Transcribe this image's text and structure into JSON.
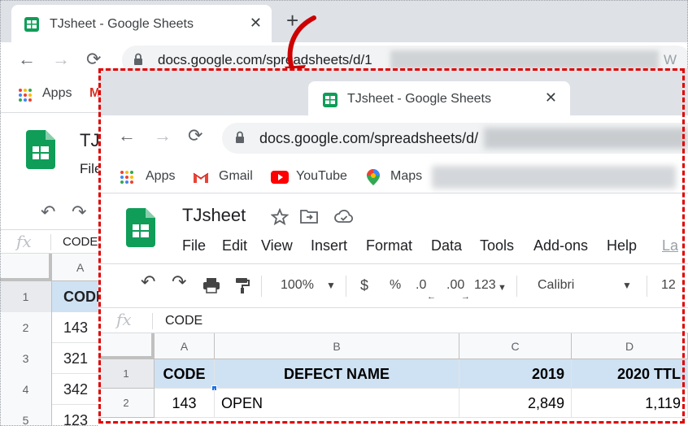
{
  "background_window": {
    "tab_title": "TJsheet - Google Sheets",
    "tab_close": "✕",
    "new_tab": "+",
    "url": "docs.google.com/spreadsheets/d/1",
    "url_tail": "W",
    "bookmarks": {
      "apps": "Apps",
      "gmail_letter": "M"
    },
    "doc_title": "TJs",
    "menu_file": "File",
    "formula_value": "CODE",
    "column": "A",
    "rows": [
      {
        "num": "1",
        "value": "CODE"
      },
      {
        "num": "2",
        "value": "143"
      },
      {
        "num": "3",
        "value": "321"
      },
      {
        "num": "4",
        "value": "342"
      },
      {
        "num": "5",
        "value": "123"
      }
    ]
  },
  "foreground_window": {
    "tab_title": "TJsheet - Google Sheets",
    "tab_close": "✕",
    "nav": {
      "back": "←",
      "forward": "→",
      "reload": "⟳"
    },
    "url": "docs.google.com/spreadsheets/d/",
    "bookmarks": [
      {
        "label": "Apps"
      },
      {
        "label": "Gmail"
      },
      {
        "label": "YouTube"
      },
      {
        "label": "Maps"
      }
    ],
    "doc_title": "TJsheet",
    "menu": [
      "File",
      "Edit",
      "View",
      "Insert",
      "Format",
      "Data",
      "Tools",
      "Add-ons",
      "Help",
      "La"
    ],
    "toolbar": {
      "zoom": "100%",
      "currency": "$",
      "percent": "%",
      "decrease_decimal": ".0",
      "increase_decimal": ".00",
      "more_formats": "123",
      "font": "Calibri",
      "font_size": "12"
    },
    "formula_bar": {
      "fx": "fx",
      "value": "CODE"
    },
    "columns": [
      "A",
      "B",
      "C",
      "D"
    ],
    "rows": [
      {
        "num": "1",
        "cells": [
          "CODE",
          "DEFECT NAME",
          "2019",
          "2020 TTL"
        ]
      },
      {
        "num": "2",
        "cells": [
          "143",
          "OPEN",
          "2,849",
          "1,119"
        ]
      }
    ]
  },
  "colors": {
    "accent": "#1a73e8",
    "header_fill": "#cfe2f3",
    "annotation_red": "#e00000",
    "sheets_green": "#0f9d58"
  }
}
